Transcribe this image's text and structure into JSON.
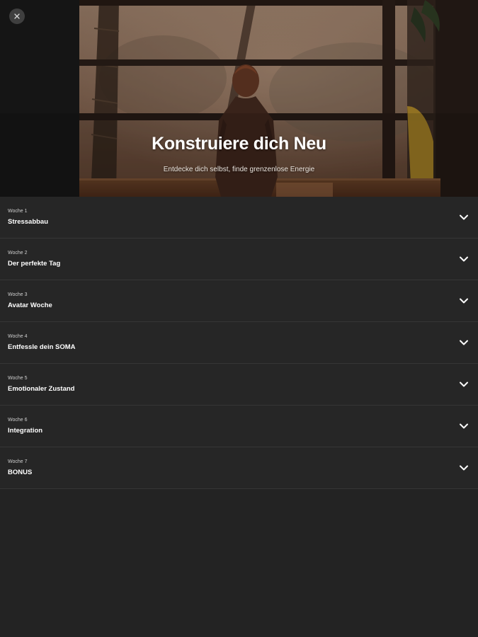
{
  "hero": {
    "title": "Konstruiere dich Neu",
    "subtitle": "Entdecke dich selbst, finde grenzenlose Energie",
    "close_icon": "close-icon"
  },
  "weeks": [
    {
      "label": "Woche 1",
      "title": "Stressabbau"
    },
    {
      "label": "Woche 2",
      "title": "Der perfekte Tag"
    },
    {
      "label": "Woche 3",
      "title": "Avatar Woche"
    },
    {
      "label": "Woche 4",
      "title": "Entfessle dein SOMA"
    },
    {
      "label": "Woche 5",
      "title": "Emotionaler Zustand"
    },
    {
      "label": "Woche 6",
      "title": "Integration"
    },
    {
      "label": "Woche 7",
      "title": "BONUS"
    }
  ],
  "icons": {
    "expand": "chevron-down-icon"
  },
  "colors": {
    "background": "#232323",
    "row": "#262626",
    "divider": "#363636",
    "text": "#ffffff"
  }
}
